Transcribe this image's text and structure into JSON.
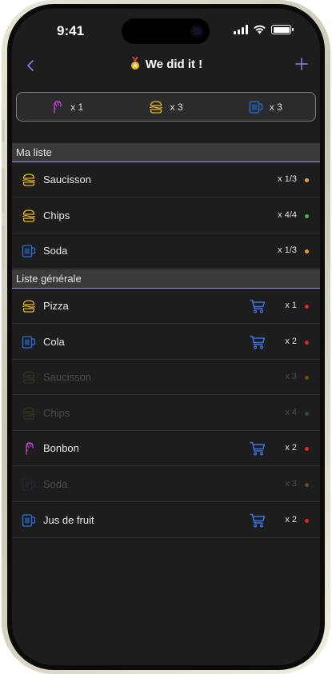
{
  "status": {
    "time": "9:41"
  },
  "header": {
    "title": "We did it !",
    "back_icon": "chevron-left-icon",
    "add_icon": "plus-icon"
  },
  "summary": [
    {
      "icon": "candy-icon",
      "count": "x 1",
      "color": "#c93ad6"
    },
    {
      "icon": "burger-icon",
      "count": "x 3",
      "color": "#e5b81f"
    },
    {
      "icon": "drink-icon",
      "count": "x 3",
      "color": "#2a6fd9"
    }
  ],
  "my_list": {
    "title": "Ma liste",
    "items": [
      {
        "icon": "burger-icon",
        "name": "Saucisson",
        "qty": "x 1/3",
        "status_color": "#f0a02a"
      },
      {
        "icon": "burger-icon",
        "name": "Chips",
        "qty": "x 4/4",
        "status_color": "#3fb84a"
      },
      {
        "icon": "drink-icon",
        "name": "Soda",
        "qty": "x 1/3",
        "status_color": "#f0a02a"
      }
    ]
  },
  "general_list": {
    "title": "Liste générale",
    "items": [
      {
        "icon": "burger-icon",
        "name": "Pizza",
        "qty": "x 1",
        "cart": true,
        "dim": false,
        "status_color": "#e52626"
      },
      {
        "icon": "drink-icon",
        "name": "Cola",
        "qty": "x 2",
        "cart": true,
        "dim": false,
        "status_color": "#e52626"
      },
      {
        "icon": "burger-icon",
        "name": "Saucisson",
        "qty": "x 3",
        "cart": false,
        "dim": true,
        "status_color": "#f0a02a"
      },
      {
        "icon": "burger-icon",
        "name": "Chips",
        "qty": "x 4",
        "cart": false,
        "dim": true,
        "status_color": "#3fb84a"
      },
      {
        "icon": "candy-icon",
        "name": "Bonbon",
        "qty": "x 2",
        "cart": true,
        "dim": false,
        "status_color": "#e52626"
      },
      {
        "icon": "drink-icon",
        "name": "Soda",
        "qty": "x 3",
        "cart": false,
        "dim": true,
        "status_color": "#f0a02a"
      },
      {
        "icon": "drink-icon",
        "name": "Jus de fruit",
        "qty": "x 2",
        "cart": true,
        "dim": false,
        "status_color": "#e52626"
      }
    ]
  },
  "colors": {
    "accent": "#8a7fe8",
    "cart": "#3c73e6",
    "burger": "#e5b81f",
    "drink": "#2a6fd9",
    "candy": "#c93ad6"
  }
}
